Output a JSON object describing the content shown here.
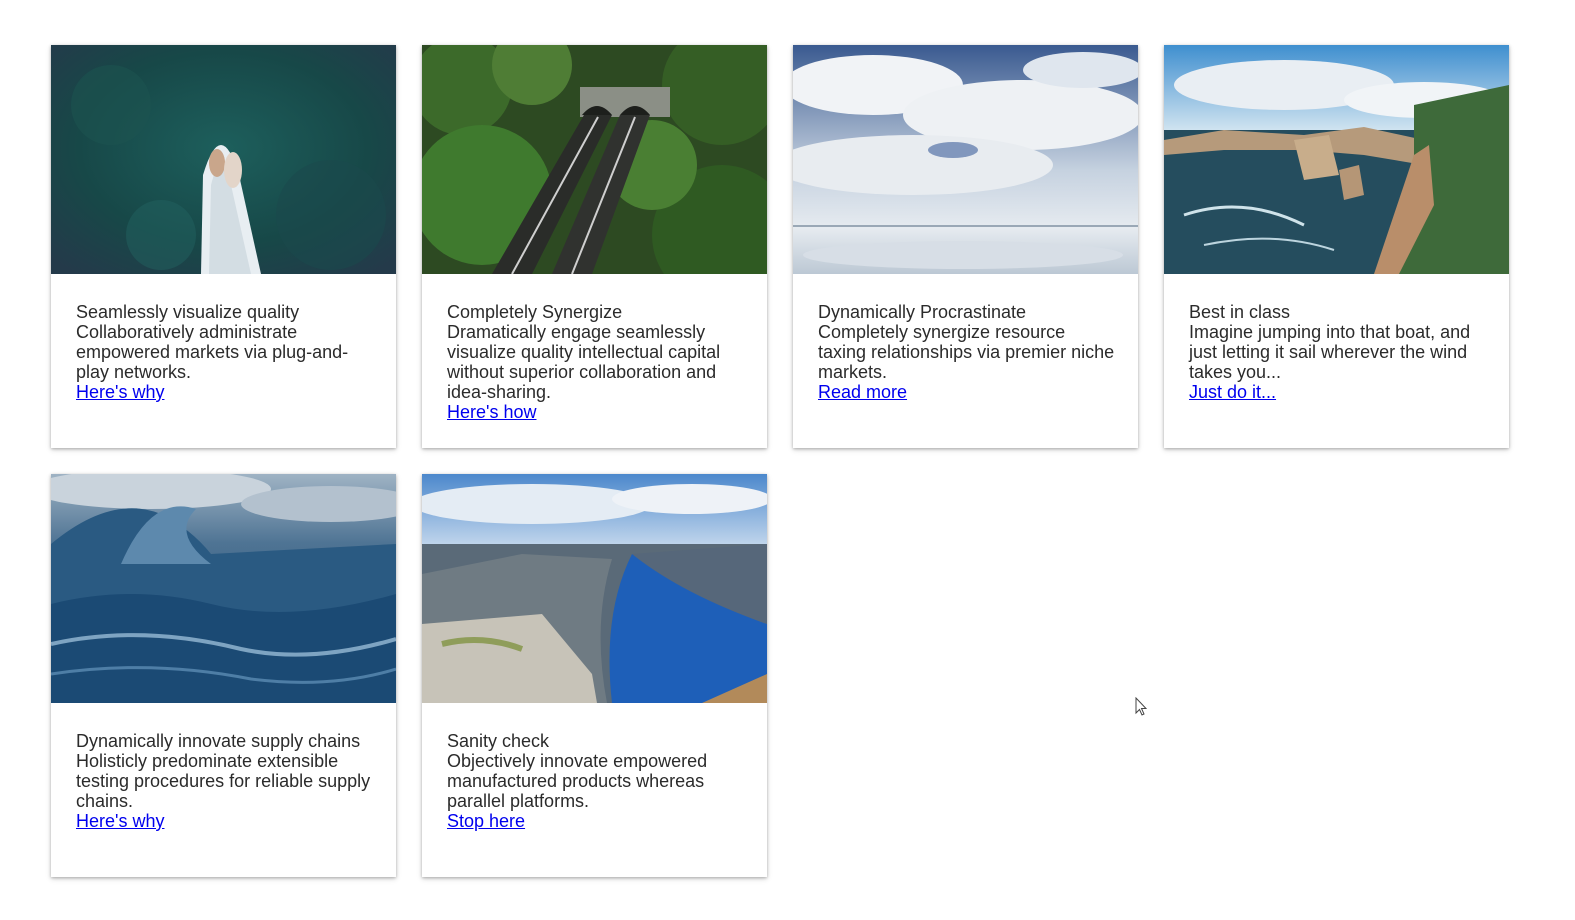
{
  "cards": [
    {
      "image_icon": "boat-aerial-image",
      "title": "Seamlessly visualize quality",
      "text": "Collaboratively administrate empowered markets via plug-and-play networks.",
      "link": "Here's why"
    },
    {
      "image_icon": "forest-tunnel-image",
      "title": "Completely Synergize",
      "text": "Dramatically engage seamlessly visualize quality intellectual capital without superior collaboration and idea-sharing.",
      "link": "Here's how"
    },
    {
      "image_icon": "cloudy-sky-reflection-image",
      "title": "Dynamically Procrastinate",
      "text": "Completely synergize resource taxing relationships via premier niche markets.",
      "link": "Read more"
    },
    {
      "image_icon": "sea-cliffs-image",
      "title": "Best in class",
      "text": "Imagine jumping into that boat, and just letting it sail wherever the wind takes you...",
      "link": "Just do it..."
    },
    {
      "image_icon": "ocean-wave-image",
      "title": "Dynamically innovate supply chains",
      "text": "Holisticly predominate extensible testing procedures for reliable supply chains.",
      "link": "Here's why"
    },
    {
      "image_icon": "fjord-cliff-image",
      "title": "Sanity check",
      "text": "Objectively innovate empowered manufactured products whereas parallel platforms.",
      "link": "Stop here"
    }
  ],
  "colors": {
    "link": "#0000ee",
    "text": "#2b2b2b",
    "background": "#ffffff"
  }
}
